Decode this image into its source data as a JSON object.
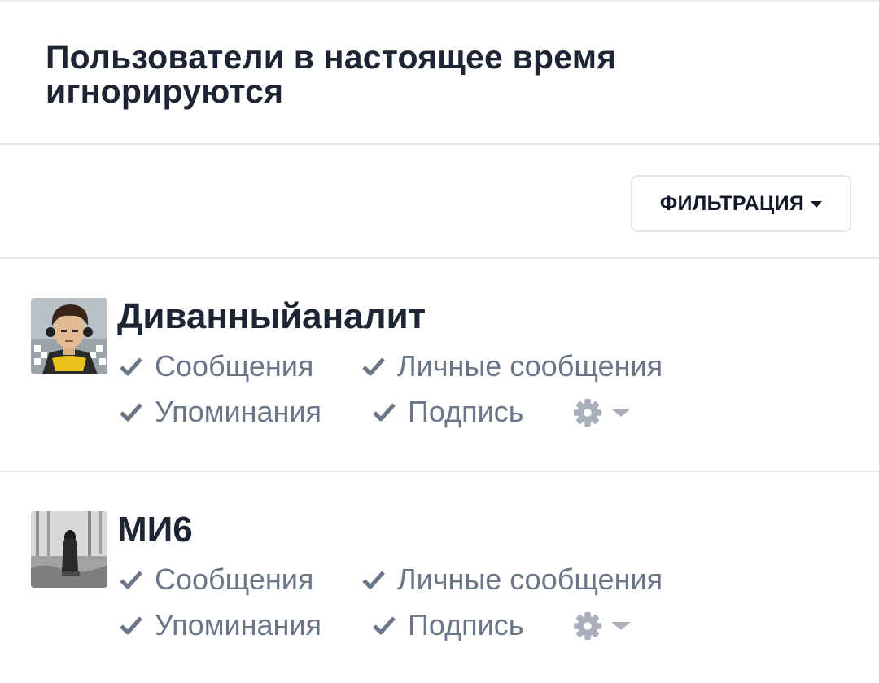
{
  "header": {
    "title": "Пользователи в настоящее время игнорируются"
  },
  "toolbar": {
    "filter_label": "ФИЛЬТРАЦИЯ"
  },
  "users": [
    {
      "name": "Диванныйаналит",
      "options": {
        "messages": "Сообщения",
        "private_messages": "Личные сообщения",
        "mentions": "Упоминания",
        "signature": "Подпись"
      }
    },
    {
      "name": "МИ6",
      "options": {
        "messages": "Сообщения",
        "private_messages": "Личные сообщения",
        "mentions": "Упоминания",
        "signature": "Подпись"
      }
    }
  ],
  "icons": {
    "check": "check-icon",
    "gear": "gear-icon",
    "caret": "caret-down-icon"
  },
  "colors": {
    "title": "#1d2433",
    "option_text": "#6b7689",
    "divider": "#e5e7eb",
    "gear": "#a9b0bc"
  }
}
